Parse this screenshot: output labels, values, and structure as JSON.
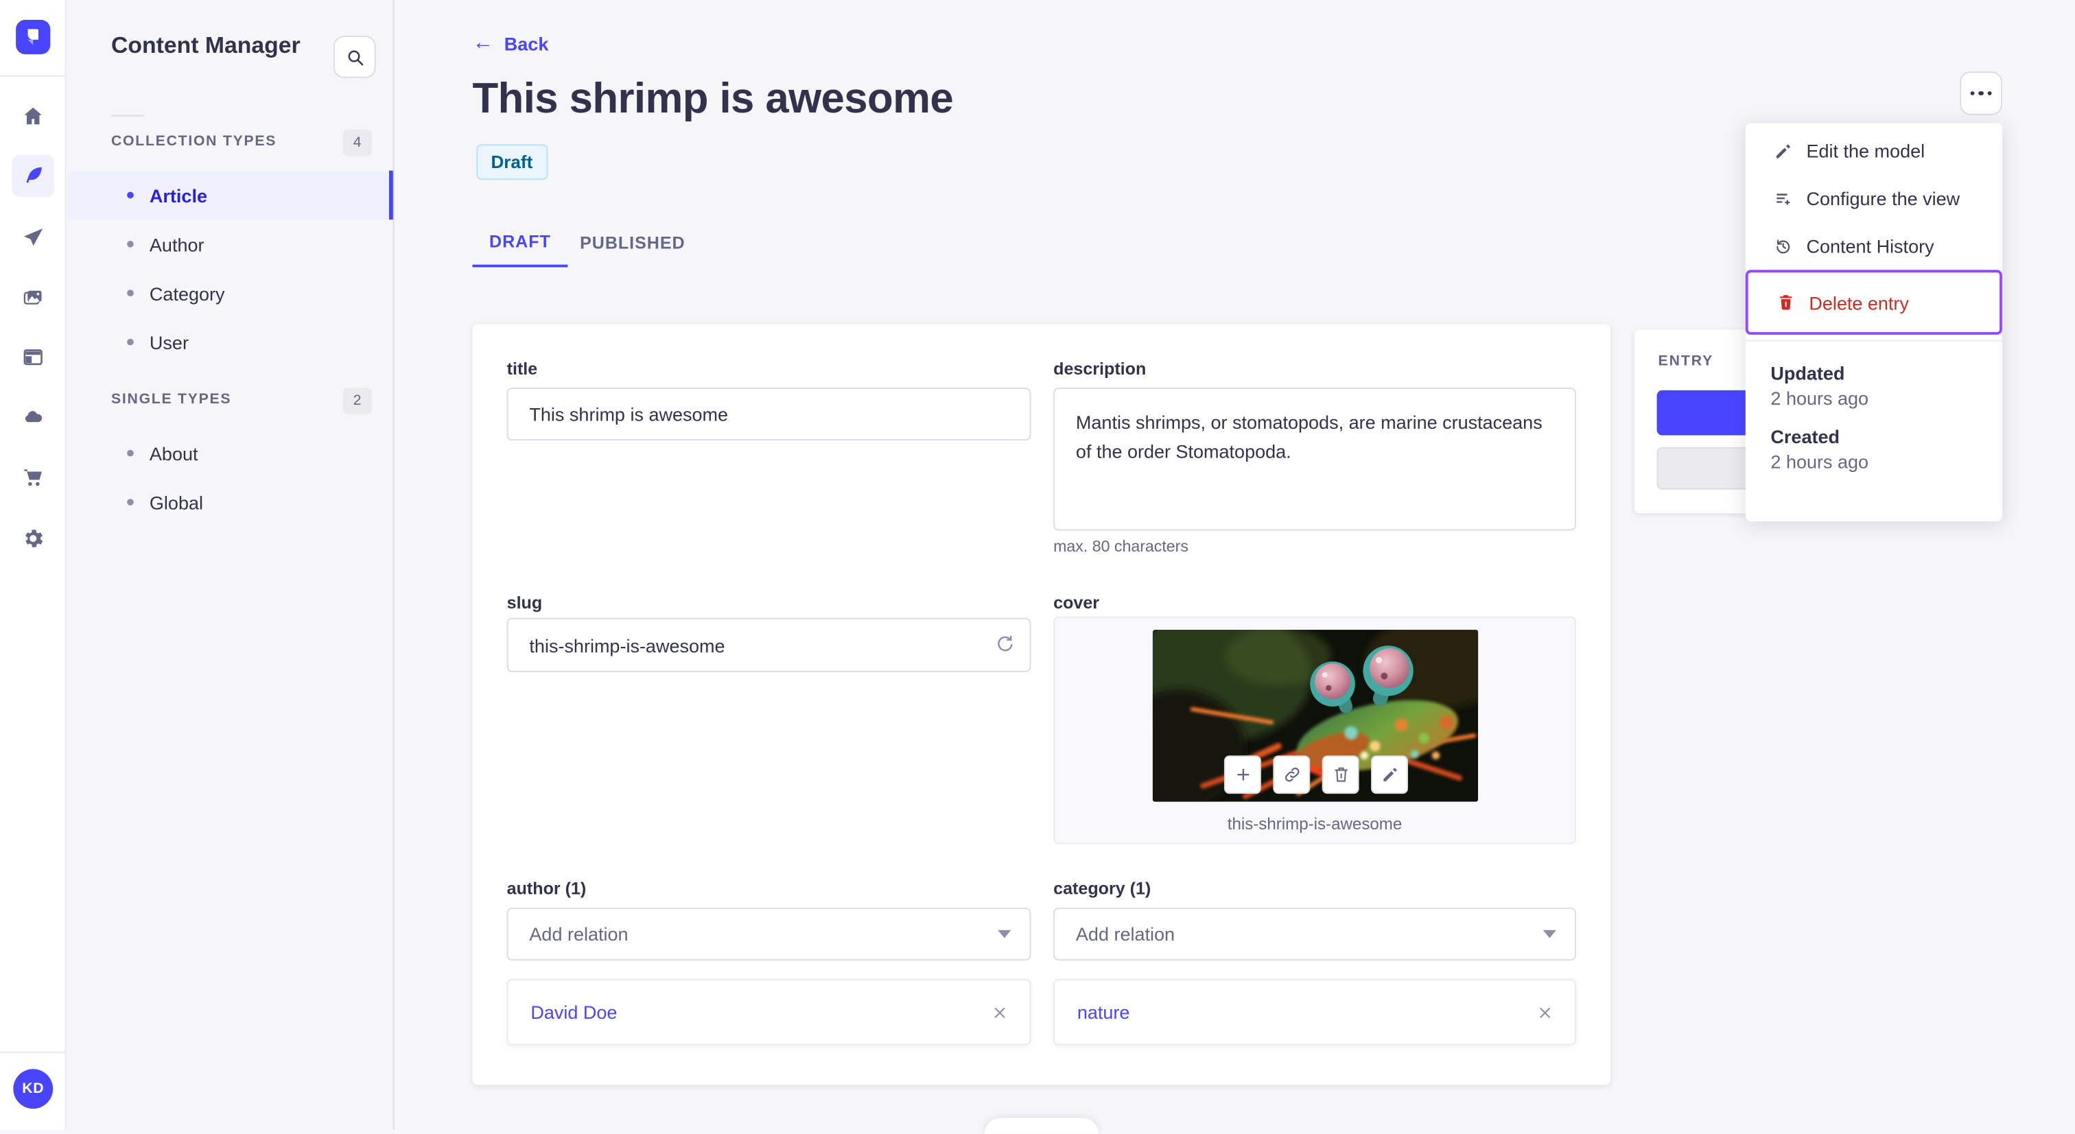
{
  "rail": {
    "logo_icon": "strapi-logo",
    "avatar_initials": "KD",
    "items": [
      {
        "icon": "home-icon"
      },
      {
        "icon": "feather-icon",
        "active": true
      },
      {
        "icon": "paper-plane-icon"
      },
      {
        "icon": "media-library-icon"
      },
      {
        "icon": "layout-icon"
      },
      {
        "icon": "cloud-icon"
      },
      {
        "icon": "cart-icon"
      },
      {
        "icon": "gear-icon"
      }
    ]
  },
  "sidebar": {
    "title": "Content Manager",
    "search_icon": "search-icon",
    "groups": [
      {
        "label": "COLLECTION TYPES",
        "count": "4",
        "items": [
          {
            "label": "Article",
            "active": true
          },
          {
            "label": "Author"
          },
          {
            "label": "Category"
          },
          {
            "label": "User"
          }
        ]
      },
      {
        "label": "SINGLE TYPES",
        "count": "2",
        "items": [
          {
            "label": "About"
          },
          {
            "label": "Global"
          }
        ]
      }
    ]
  },
  "header": {
    "back_label": "Back",
    "title": "This shrimp is awesome",
    "status_badge": "Draft",
    "more_icon": "ellipsis-icon",
    "tabs": [
      {
        "label": "DRAFT",
        "active": true
      },
      {
        "label": "PUBLISHED"
      }
    ]
  },
  "form": {
    "title_field": {
      "label": "title",
      "value": "This shrimp is awesome"
    },
    "description_field": {
      "label": "description",
      "value": "Mantis shrimps, or stomatopods, are marine crustaceans of the order Stomatopoda.",
      "hint": "max. 80 characters"
    },
    "slug_field": {
      "label": "slug",
      "value": "this-shrimp-is-awesome",
      "icon": "regenerate-icon"
    },
    "cover_field": {
      "label": "cover",
      "caption": "this-shrimp-is-awesome",
      "action_icons": [
        "plus-icon",
        "link-icon",
        "trash-icon",
        "pencil-icon"
      ]
    },
    "author_field": {
      "label": "author (1)",
      "placeholder": "Add relation",
      "items": [
        {
          "label": "David Doe"
        }
      ]
    },
    "category_field": {
      "label": "category (1)",
      "placeholder": "Add relation",
      "items": [
        {
          "label": "nature"
        }
      ]
    }
  },
  "entry_panel": {
    "label": "ENTRY"
  },
  "menu": {
    "items": [
      {
        "label": "Edit the model",
        "icon": "pencil-icon"
      },
      {
        "label": "Configure the view",
        "icon": "configure-view-icon"
      },
      {
        "label": "Content History",
        "icon": "history-icon"
      },
      {
        "label": "Delete entry",
        "icon": "trash-icon",
        "danger": true,
        "focused": true
      }
    ],
    "meta": [
      {
        "label": "Updated",
        "value": "2 hours ago"
      },
      {
        "label": "Created",
        "value": "2 hours ago"
      }
    ]
  },
  "colors": {
    "accent": "#4945ff",
    "accent_active_text": "#271fe0",
    "danger": "#d02b20",
    "draft_bg": "#eaf5ff",
    "draft_border": "#b8e1ff",
    "draft_text": "#006096",
    "focus_ring": "#9747ff",
    "text_dark": "#32324d",
    "text_gray": "#666687",
    "border_light": "#eaeaef",
    "border_input": "#dcdce4",
    "background": "#f6f6f9"
  }
}
